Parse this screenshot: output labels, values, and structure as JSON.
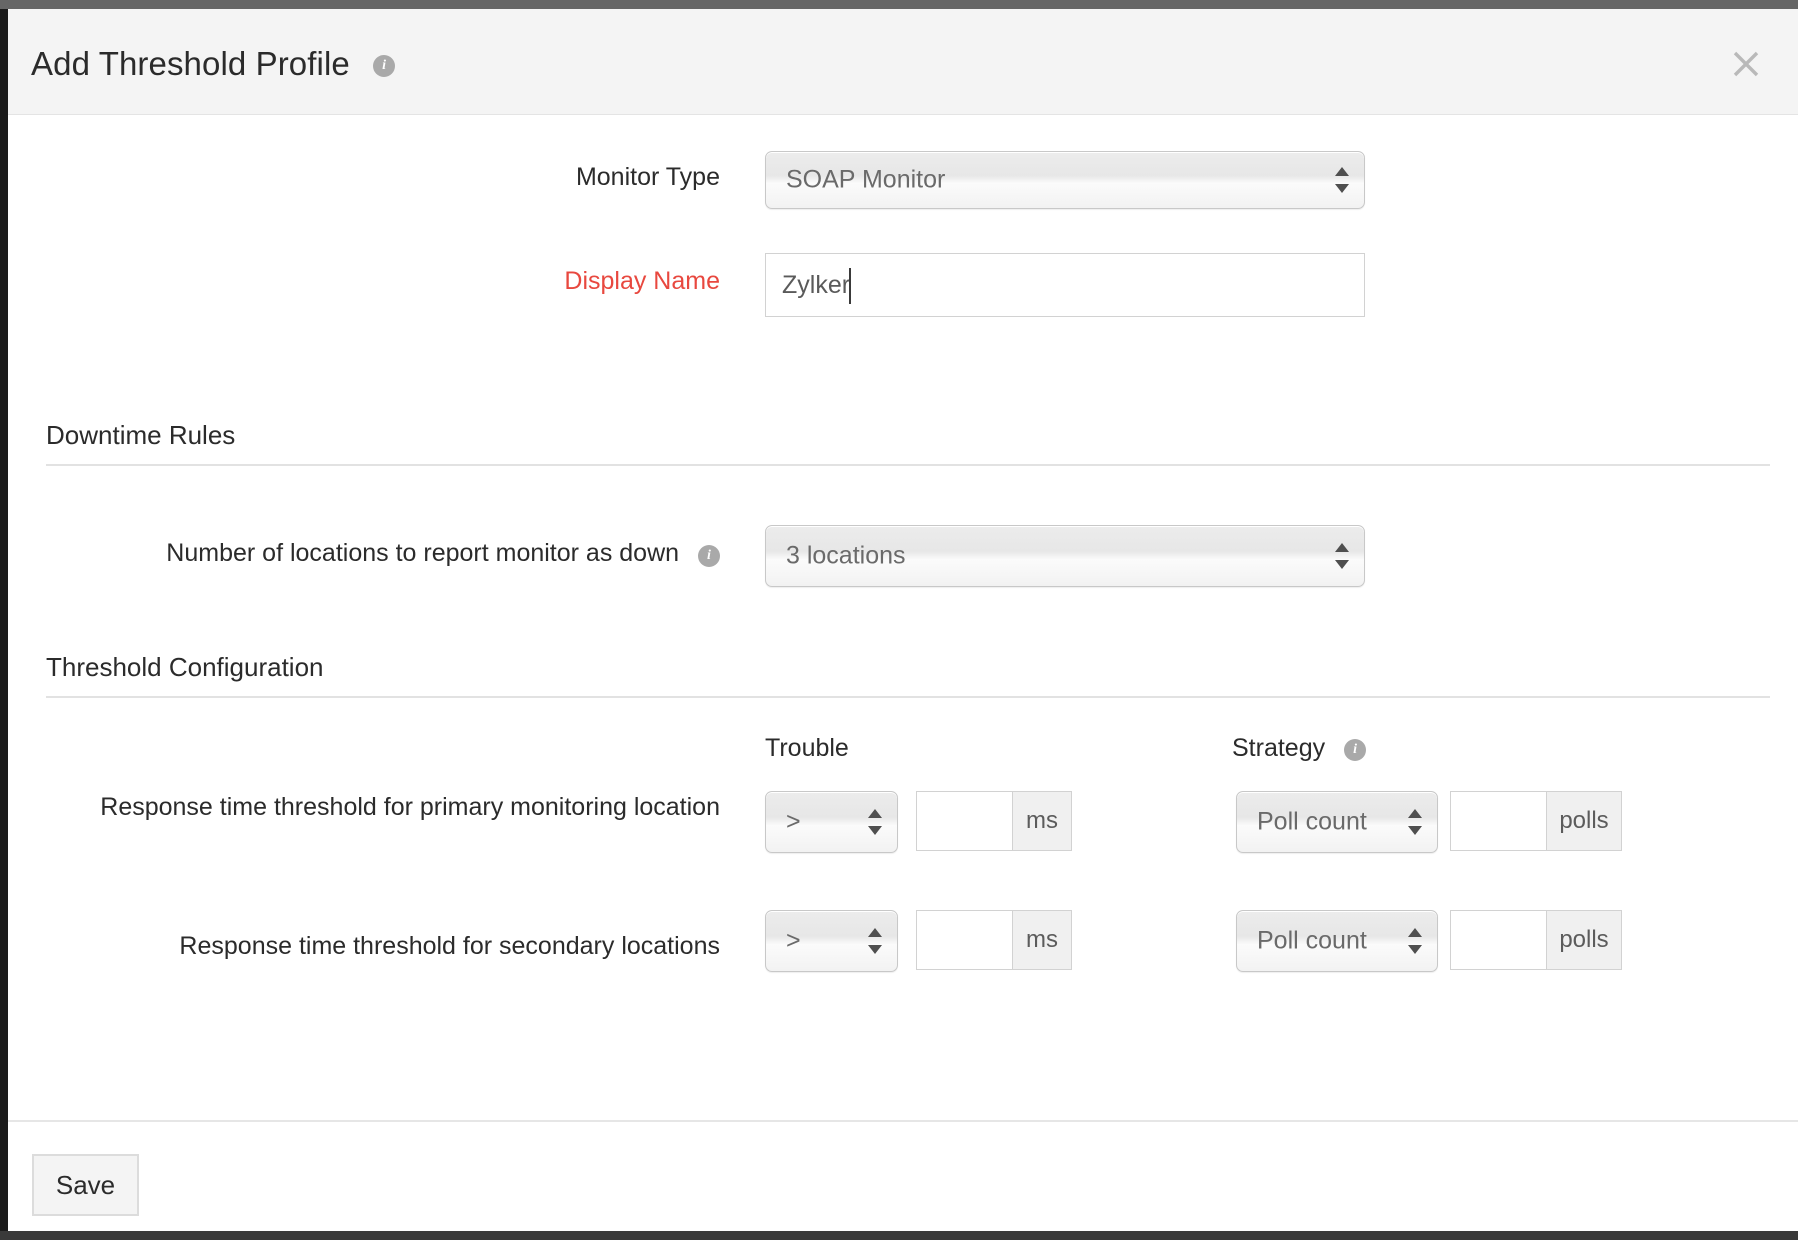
{
  "window": {
    "title": "Add Threshold Profile",
    "title_info_icon": "info-icon",
    "close_icon": "close-icon"
  },
  "form": {
    "monitor_type": {
      "label": "Monitor Type",
      "value": "SOAP Monitor"
    },
    "display_name": {
      "label": "Display Name",
      "value": "Zylker",
      "placeholder": "",
      "required": true
    }
  },
  "downtime_rules": {
    "title": "Downtime Rules",
    "locations": {
      "label": "Number of locations to report monitor as down",
      "info_icon": "info-icon",
      "value": "3 locations"
    }
  },
  "threshold_configuration": {
    "title": "Threshold Configuration",
    "columns": {
      "trouble": "Trouble",
      "strategy": "Strategy",
      "strategy_info_icon": "info-icon"
    },
    "rows": [
      {
        "label": "Response time threshold for primary monitoring location",
        "trouble_operator": ">",
        "trouble_value": "",
        "trouble_unit": "ms",
        "strategy_type": "Poll count",
        "strategy_value": "",
        "strategy_unit": "polls"
      },
      {
        "label": "Response time threshold for secondary locations",
        "trouble_operator": ">",
        "trouble_value": "",
        "trouble_unit": "ms",
        "strategy_type": "Poll count",
        "strategy_value": "",
        "strategy_unit": "polls"
      }
    ]
  },
  "footer": {
    "save_label": "Save"
  },
  "colors": {
    "required_label": "#e8483f",
    "header_bg": "#f4f4f4",
    "text": "#2b2b2b",
    "muted_text": "#6a6a6a"
  }
}
